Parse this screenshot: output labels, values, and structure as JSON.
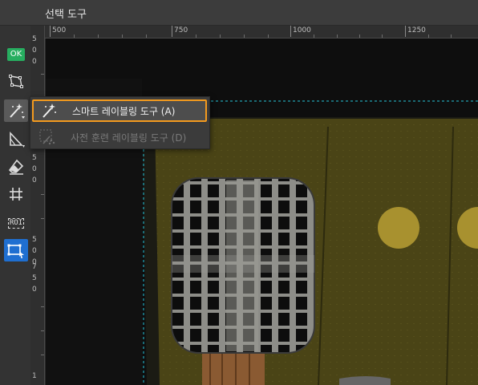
{
  "window": {
    "title": "선택 도구"
  },
  "horizontal_ruler": {
    "labels": [
      "500",
      "750",
      "1000",
      "1250"
    ]
  },
  "vertical_ruler": {
    "labels": [
      "5",
      "0",
      "0",
      "5",
      "0",
      "0",
      "5",
      "0",
      "0",
      "7",
      "5",
      "0",
      "1"
    ]
  },
  "toolbar": {
    "ok_badge": "OK",
    "tools": [
      {
        "icon": "polygon-icon"
      },
      {
        "icon": "magic-wand-icon",
        "state": "active"
      },
      {
        "icon": "brush-icon"
      },
      {
        "icon": "eraser-icon"
      },
      {
        "icon": "grid-icon"
      },
      {
        "icon": "roi-icon",
        "label": "ROI"
      },
      {
        "icon": "select-rectangle-icon",
        "state": "selected"
      }
    ]
  },
  "flyout_menu": {
    "items": [
      {
        "label": "스마트 레이블링 도구 (A)",
        "icon": "magic-wand-icon",
        "state": "highlighted"
      },
      {
        "label": "사전 훈련 레이블링 도구 (D)",
        "icon": "pretrained-wand-icon",
        "state": "disabled"
      }
    ]
  },
  "colors": {
    "highlight_border": "#f39a1e",
    "ok_badge": "#27ae60",
    "selected_tool": "#1f6fd1",
    "roi_guide": "#26c6da"
  }
}
